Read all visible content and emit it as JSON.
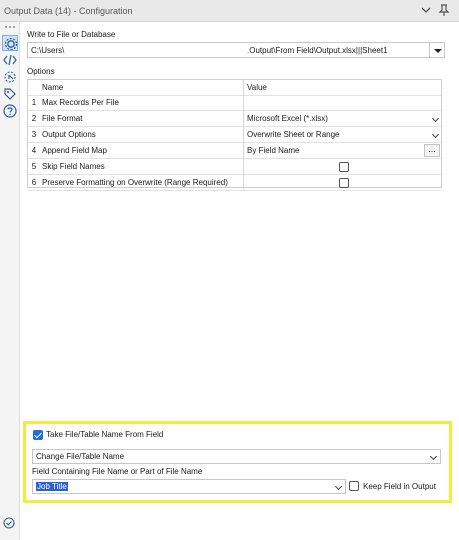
{
  "window": {
    "title": "Output Data (14) - Configuration"
  },
  "sidebar": {
    "items": [
      {
        "icon": "gear-icon"
      },
      {
        "icon": "xml-icon"
      },
      {
        "icon": "cursor-icon"
      },
      {
        "icon": "tag-icon"
      },
      {
        "icon": "help-icon"
      }
    ],
    "status_icon": "check-circle-icon"
  },
  "config": {
    "write_label": "Write to File or Database",
    "path_left": "C:\\Users\\",
    "path_right": ".Output\\From Field\\Output.xlsx|||Sheet1",
    "options_label": "Options",
    "columns": {
      "name": "Name",
      "value": "Value"
    },
    "rows": [
      {
        "num": "1",
        "name": "Max Records Per File",
        "value": ""
      },
      {
        "num": "2",
        "name": "File Format",
        "value": "Microsoft Excel (*.xlsx)"
      },
      {
        "num": "3",
        "name": "Output Options",
        "value": "Overwrite Sheet or Range"
      },
      {
        "num": "4",
        "name": "Append Field Map",
        "value": "By Field Name",
        "button": "..."
      },
      {
        "num": "5",
        "name": "Skip Field Names",
        "value": ""
      },
      {
        "num": "6",
        "name": "Preserve Formatting on Overwrite (Range Required)",
        "value": ""
      }
    ]
  },
  "field_options": {
    "take_name_label": "Take File/Table Name From Field",
    "take_name_checked": true,
    "mode_value": "Change File/Table Name",
    "field_label": "Field Containing File Name or Part of File Name",
    "field_value": "Job Title",
    "keep_field_label": "Keep Field in Output",
    "keep_field_checked": false
  },
  "colors": {
    "highlight": "#f4ec3c",
    "accent": "#1e6fd9",
    "selection": "#2a61d6"
  }
}
